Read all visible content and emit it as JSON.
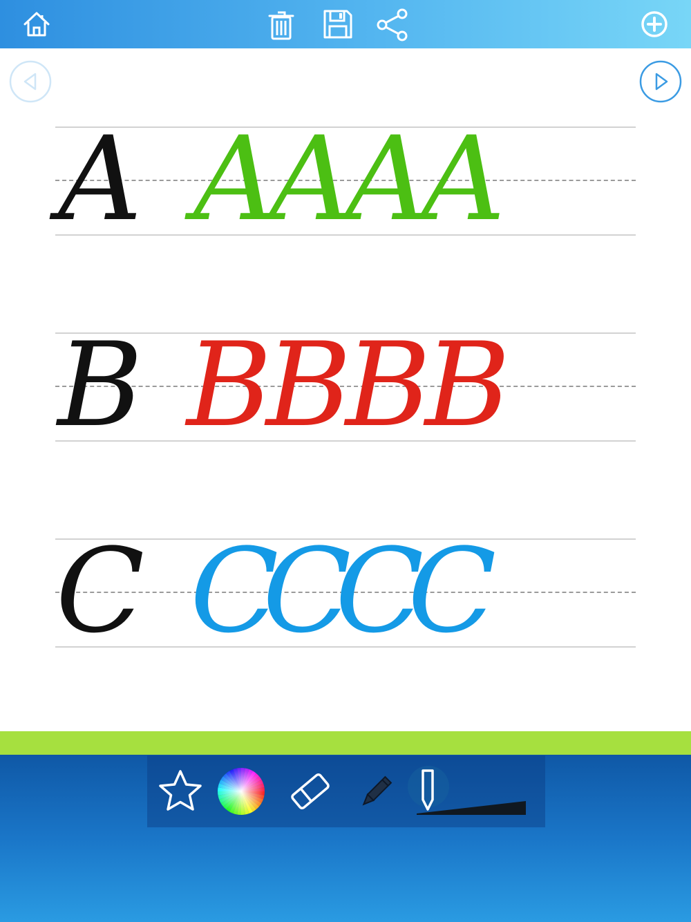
{
  "toolbar": {
    "icons": [
      "home-icon",
      "trash-icon",
      "save-icon",
      "share-icon",
      "add-icon"
    ]
  },
  "navigation": {
    "icons": [
      "previous-page-icon",
      "next-page-icon"
    ]
  },
  "rows": [
    {
      "model": "A",
      "practice": [
        "A",
        "A",
        "A",
        "A"
      ],
      "color": "#4cbf13"
    },
    {
      "model": "B",
      "practice": [
        "B",
        "B",
        "B",
        "B"
      ],
      "color": "#e0241a"
    },
    {
      "model": "C",
      "practice": [
        "C",
        "C",
        "C",
        "C"
      ],
      "color": "#149ae6"
    }
  ],
  "colors": {
    "toolbar_start": "#2e8fe0",
    "toolbar_end": "#78d6f7",
    "accent_strip": "#a6e03f",
    "bottom_bar": "#1a76c8",
    "model_ink": "#111111"
  },
  "tools": {
    "icons": [
      "star-icon",
      "color-wheel-icon",
      "eraser-icon",
      "pencil-icon",
      "pen-icon",
      "stroke-width-slider"
    ]
  }
}
